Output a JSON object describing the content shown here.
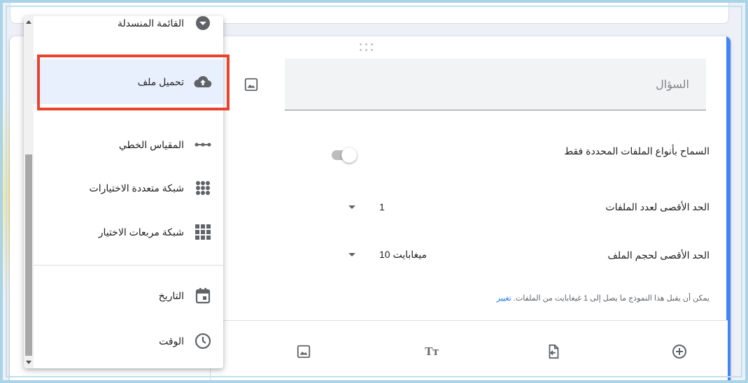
{
  "question": {
    "placeholder": "السؤال"
  },
  "settings": {
    "allow_specific_types_label": "السماح بأنواع الملفات المحددة فقط",
    "max_files_label": "الحد الأقصى لعدد الملفات",
    "max_files_value": "1",
    "max_size_label": "الحد الأقصى لحجم الملف",
    "max_size_value": "10 ميغابايت",
    "note_text": "يمكن أن يقبل هذا النموذج ما يصل إلى 1 غيغابايت من الملفات.",
    "note_link": "تغيير",
    "allow_specific_types_on": false
  },
  "menu": {
    "items": [
      {
        "label": "القائمة المنسدلة",
        "icon": "dropdown-circle-icon"
      },
      {
        "label": "تحميل ملف",
        "icon": "cloud-upload-icon",
        "selected": true
      },
      {
        "label": "المقياس الخطي",
        "icon": "linear-scale-icon"
      },
      {
        "label": "شبكة متعددة الاختيارات",
        "icon": "dots-grid-icon"
      },
      {
        "label": "شبكة مربعات الاختيار",
        "icon": "checkbox-grid-icon"
      },
      {
        "label": "التاريخ",
        "icon": "calendar-icon"
      },
      {
        "label": "الوقت",
        "icon": "clock-icon"
      }
    ]
  },
  "toolbar": {
    "icons": [
      "add-circle-icon",
      "import-questions-icon",
      "title-text-icon",
      "add-image-icon"
    ]
  },
  "colors": {
    "accent": "#4285f4",
    "highlight": "#e8442d",
    "link": "#1a73e8",
    "selected_bg": "#e8f0fe"
  }
}
